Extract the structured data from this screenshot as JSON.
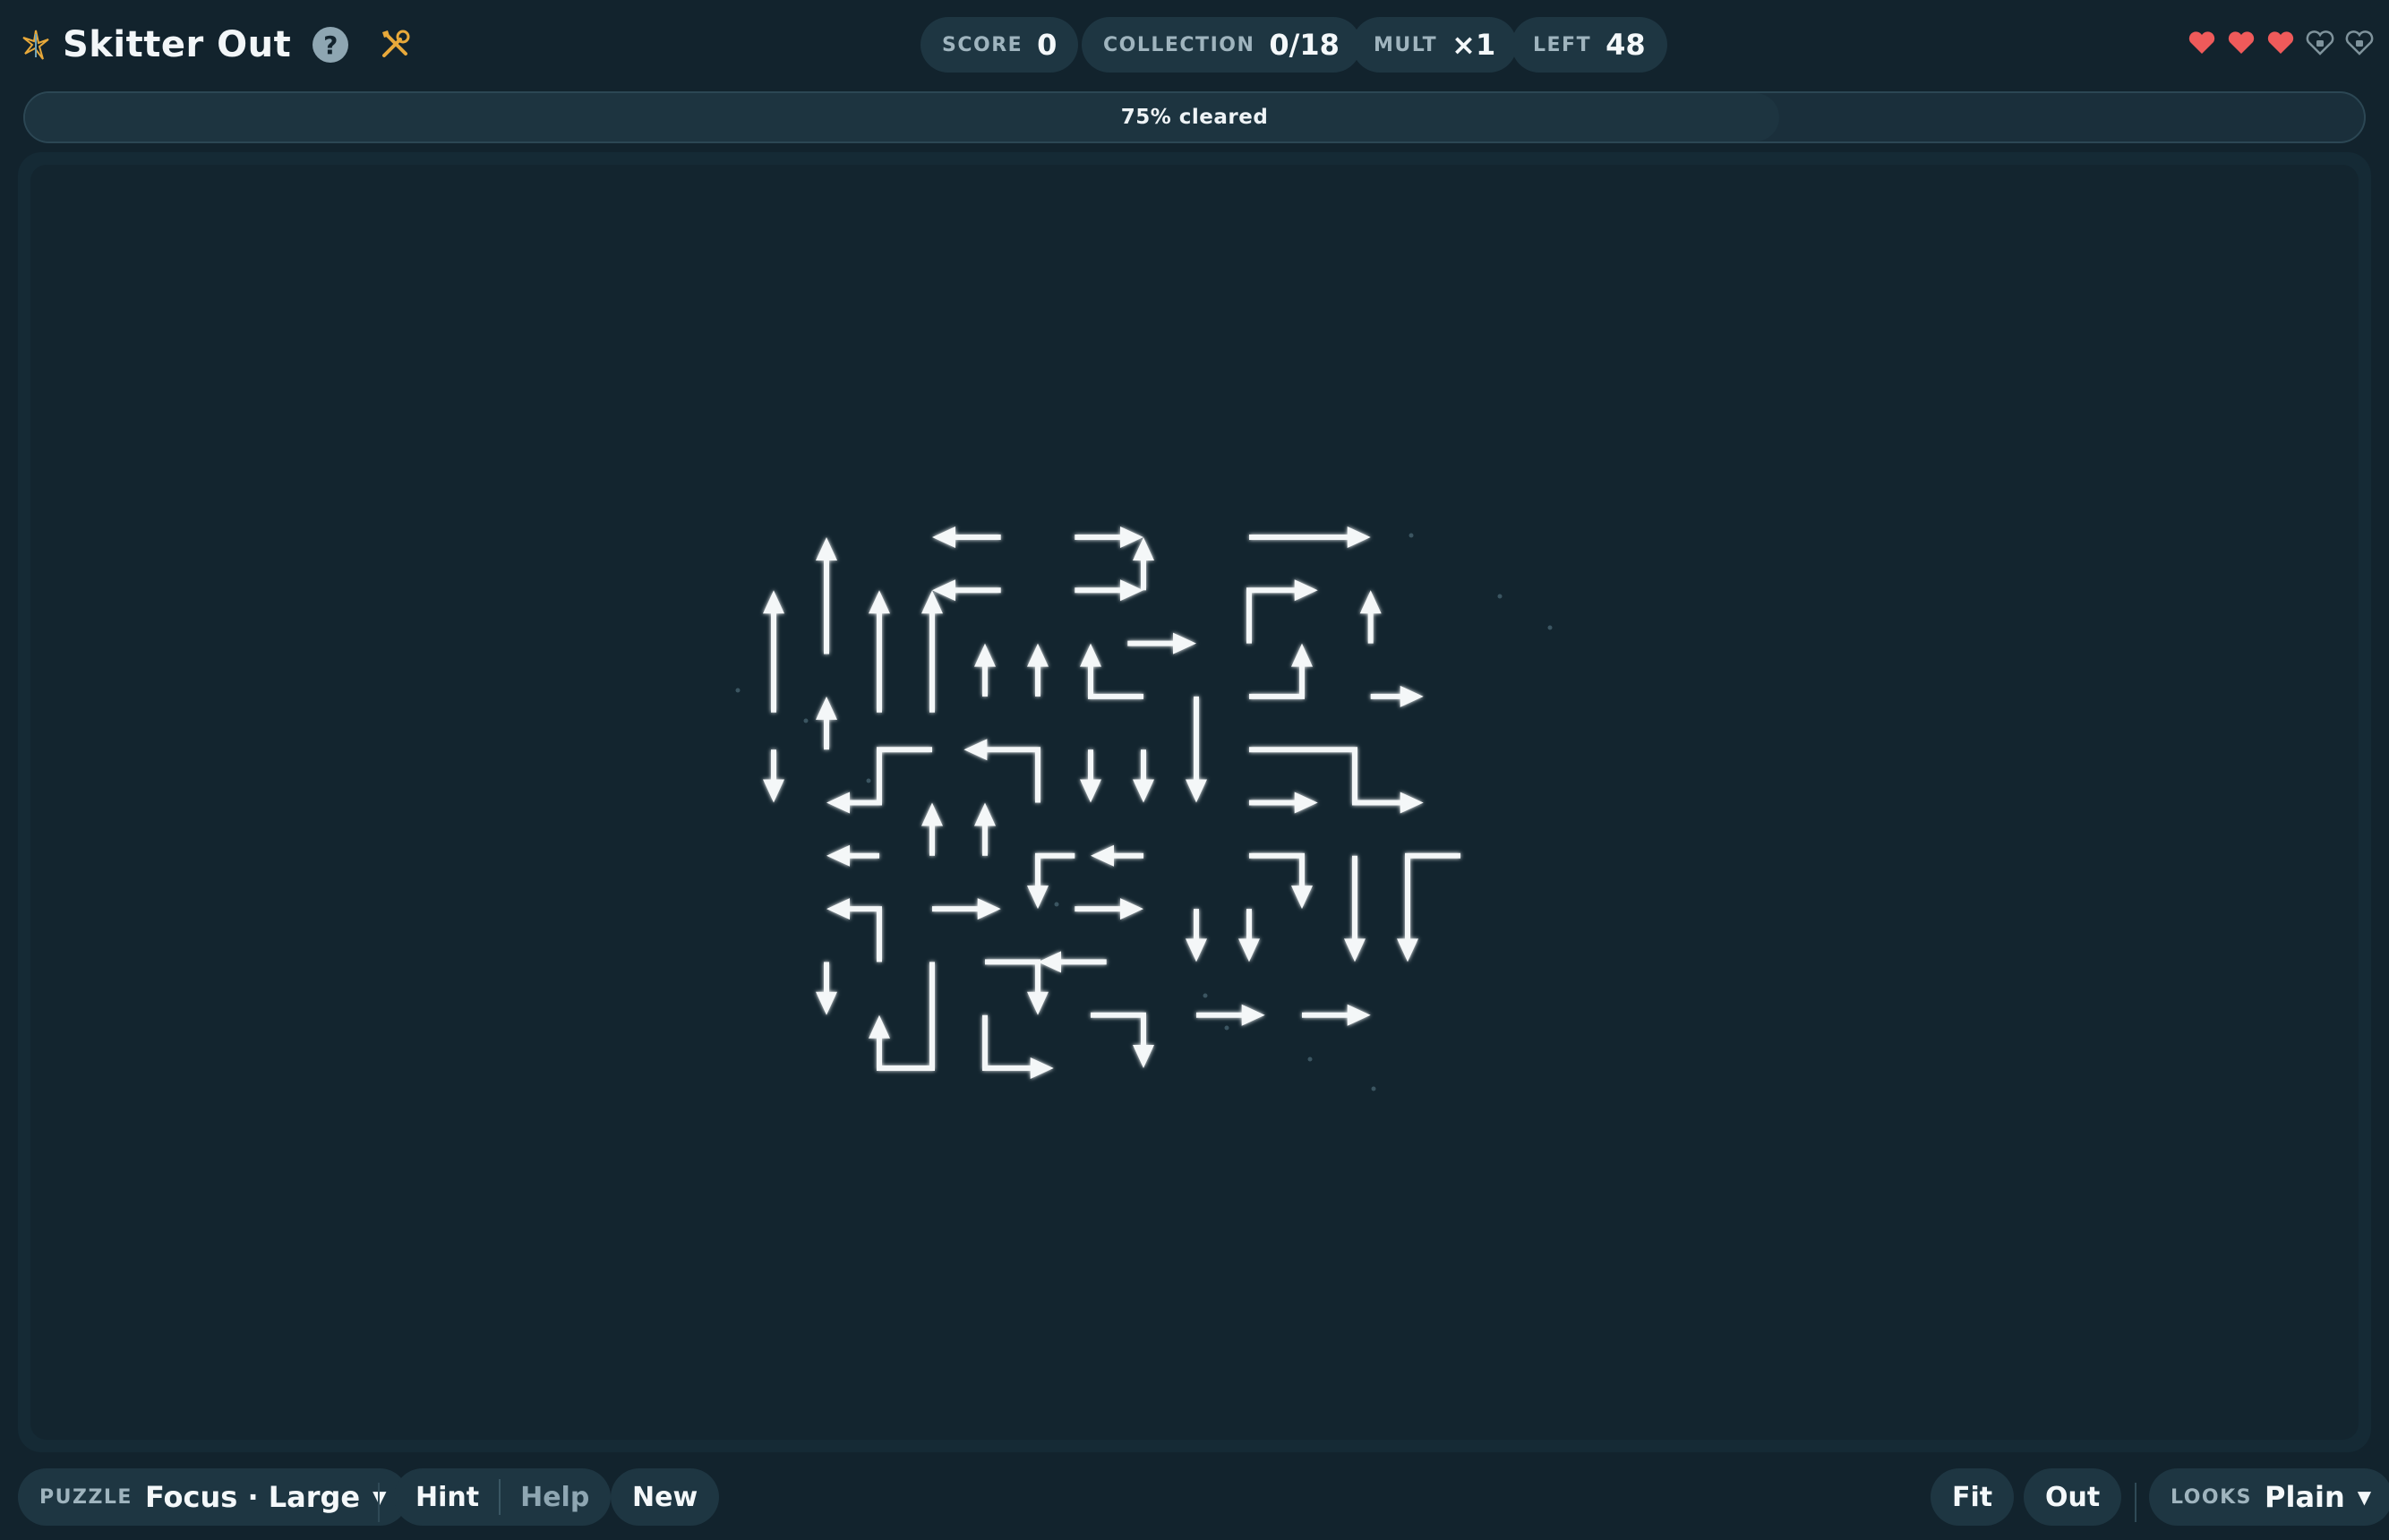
{
  "app": {
    "title": "Skitter Out"
  },
  "stats": [
    {
      "label": "SCORE",
      "value": "0"
    },
    {
      "label": "COLLECTION",
      "value": "0/18"
    },
    {
      "label": "MULT",
      "value": "×1"
    },
    {
      "label": "LEFT",
      "value": "48"
    }
  ],
  "lives": {
    "full": 3,
    "empty": 2
  },
  "progress": {
    "text": "75% cleared",
    "fraction": 0.75
  },
  "bottom": {
    "puzzle_label": "PUZZLE",
    "puzzle_value": "Focus · Large",
    "hint": "Hint",
    "help": "Help",
    "new": "New",
    "fit": "Fit",
    "out": "Out",
    "looks_label": "LOOKS",
    "looks_value": "Plain"
  },
  "colors": {
    "accent": "#e8a93a",
    "heart": "#ef5a5a",
    "arrow": "#f4f7f8",
    "board": "#13252f"
  }
}
